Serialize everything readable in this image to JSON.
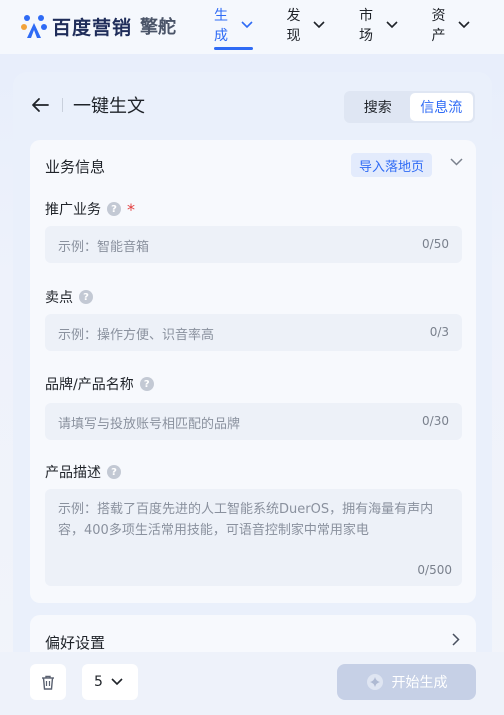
{
  "brand": {
    "name": "百度营销",
    "product": "擎舵"
  },
  "nav": {
    "items": [
      {
        "label": "生成",
        "active": true
      },
      {
        "label": "发现",
        "active": false
      },
      {
        "label": "市场",
        "active": false
      },
      {
        "label": "资产",
        "active": false
      }
    ]
  },
  "header": {
    "title": "一键生文",
    "segments": [
      {
        "label": "搜索",
        "active": false
      },
      {
        "label": "信息流",
        "active": true
      }
    ]
  },
  "business_info": {
    "title": "业务信息",
    "import_label": "导入落地页",
    "fields": [
      {
        "label": "推广业务",
        "required_mark": "*",
        "placeholder": "示例：智能音箱",
        "counter": "0/50"
      },
      {
        "label": "卖点",
        "placeholder": "示例：操作方便、识音率高",
        "counter": "0/3"
      },
      {
        "label": "品牌/产品名称",
        "placeholder": "请填写与投放账号相匹配的品牌",
        "counter": "0/30"
      },
      {
        "label": "产品描述",
        "placeholder": "示例：搭载了百度先进的人工智能系统DuerOS，拥有海量有声内容，400多项生活常用技能，可语音控制家中常用家电",
        "counter": "0/500"
      }
    ]
  },
  "preferences": {
    "title": "偏好设置"
  },
  "footer": {
    "count_value": "5",
    "generate_label": "开始生成"
  },
  "colors": {
    "accent": "#2f6bf5",
    "required": "#e23c3c",
    "disabled_button": "#c6d0e6"
  }
}
